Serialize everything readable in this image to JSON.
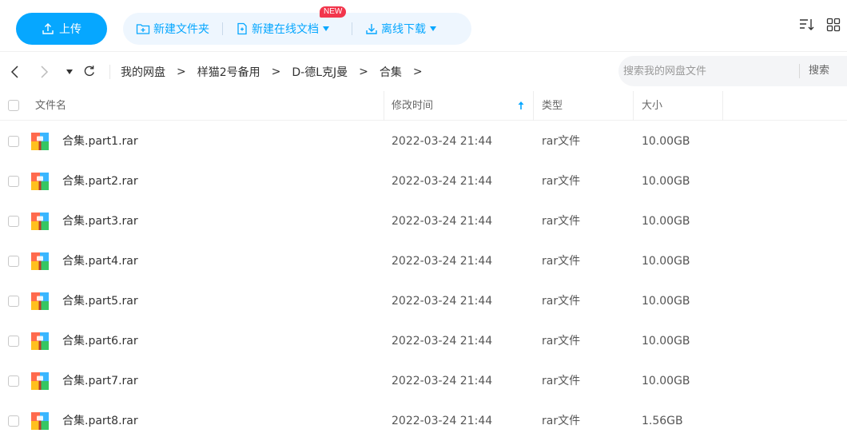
{
  "toolbar": {
    "upload_label": "上传",
    "new_folder_label": "新建文件夹",
    "new_online_doc_label": "新建在线文档",
    "new_badge": "NEW",
    "offline_download_label": "离线下载"
  },
  "nav": {
    "breadcrumbs": [
      "我的网盘",
      "样猫2号备用",
      "D-德L克J曼",
      "合集"
    ],
    "separator": ">"
  },
  "search": {
    "placeholder": "搜索我的网盘文件",
    "button_label": "搜索"
  },
  "table": {
    "columns": {
      "name": "文件名",
      "modified": "修改时间",
      "type": "类型",
      "size": "大小"
    },
    "rows": [
      {
        "name": "合集.part1.rar",
        "modified": "2022-03-24 21:44",
        "type": "rar文件",
        "size": "10.00GB"
      },
      {
        "name": "合集.part2.rar",
        "modified": "2022-03-24 21:44",
        "type": "rar文件",
        "size": "10.00GB"
      },
      {
        "name": "合集.part3.rar",
        "modified": "2022-03-24 21:44",
        "type": "rar文件",
        "size": "10.00GB"
      },
      {
        "name": "合集.part4.rar",
        "modified": "2022-03-24 21:44",
        "type": "rar文件",
        "size": "10.00GB"
      },
      {
        "name": "合集.part5.rar",
        "modified": "2022-03-24 21:44",
        "type": "rar文件",
        "size": "10.00GB"
      },
      {
        "name": "合集.part6.rar",
        "modified": "2022-03-24 21:44",
        "type": "rar文件",
        "size": "10.00GB"
      },
      {
        "name": "合集.part7.rar",
        "modified": "2022-03-24 21:44",
        "type": "rar文件",
        "size": "10.00GB"
      },
      {
        "name": "合集.part8.rar",
        "modified": "2022-03-24 21:44",
        "type": "rar文件",
        "size": "1.56GB"
      }
    ]
  },
  "icons": {
    "upload": "upload-icon",
    "new_folder": "new-folder-icon",
    "new_doc": "new-doc-icon",
    "download": "download-icon",
    "sort": "sort-icon",
    "grid_view": "grid-view-icon",
    "file": "rar-archive-icon"
  },
  "colors": {
    "accent": "#06a7ff",
    "action_bg": "#eef6fe",
    "badge": "#f2364c"
  }
}
